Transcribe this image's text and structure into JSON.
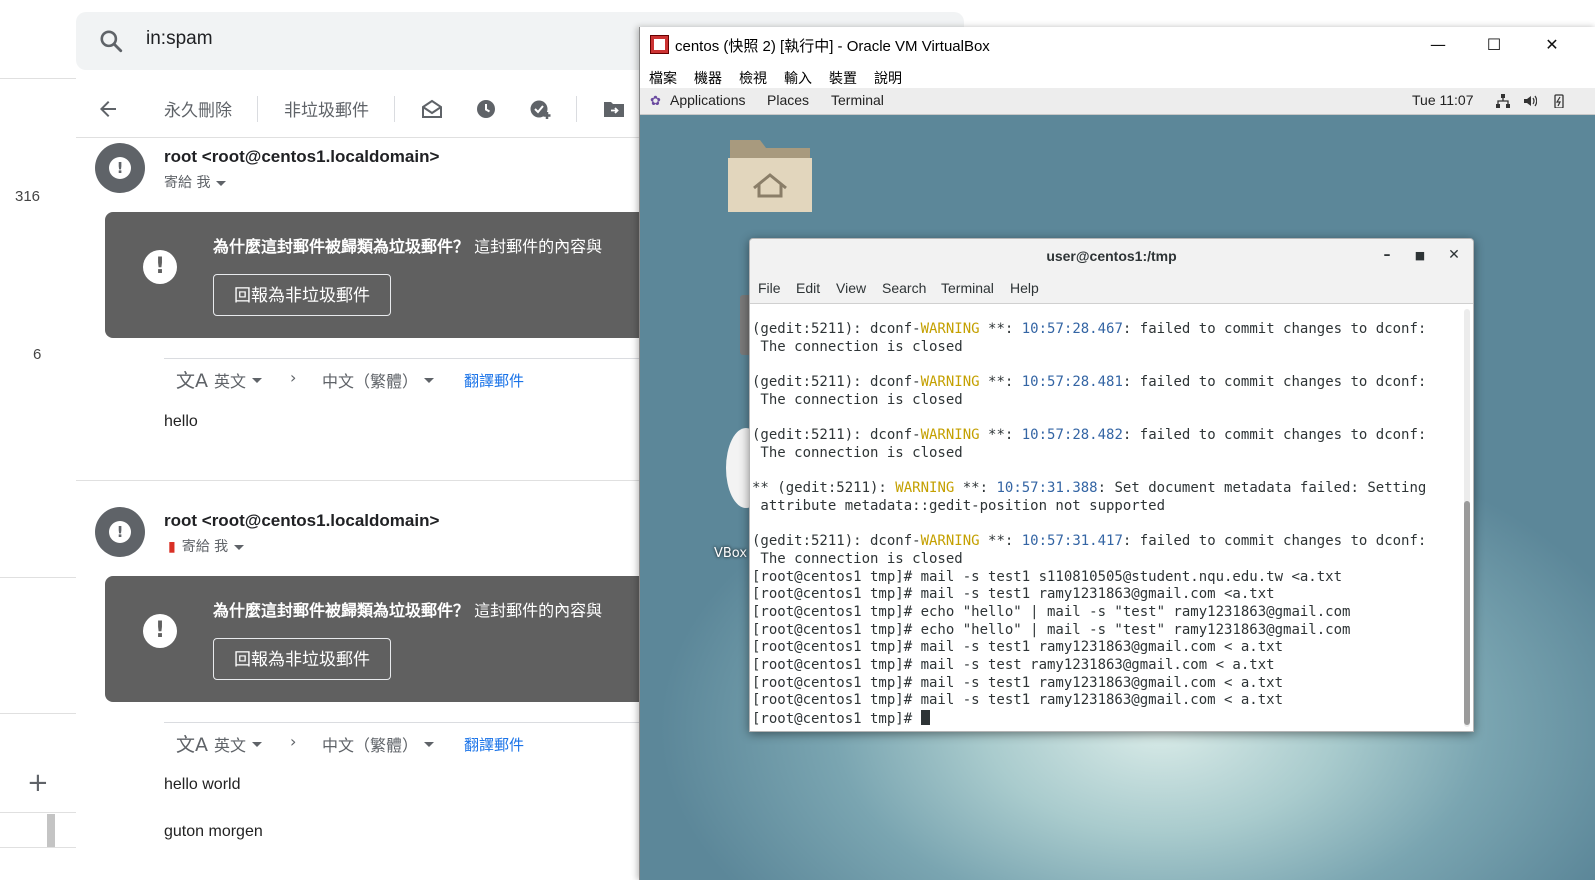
{
  "gmail": {
    "search": {
      "query": "in:spam"
    },
    "toolbar": {
      "delete_forever": "永久刪除",
      "not_spam": "非垃圾郵件"
    },
    "left_counts": [
      "316",
      "6"
    ],
    "add_label": "+",
    "messages": [
      {
        "sender": "root <root@centos1.localdomain>",
        "sent_to": "寄給 我",
        "banner_title": "為什麼這封郵件被歸類為垃圾郵件？",
        "banner_text": "這封郵件的內容與",
        "report_button": "回報為非垃圾郵件",
        "translate_from": "英文",
        "translate_to": "中文（繁體）",
        "translate_link": "翻譯郵件",
        "body": [
          "hello"
        ]
      },
      {
        "sender": "root <root@centos1.localdomain>",
        "sent_to": "寄給 我",
        "banner_title": "為什麼這封郵件被歸類為垃圾郵件？",
        "banner_text": "這封郵件的內容與",
        "report_button": "回報為非垃圾郵件",
        "translate_from": "英文",
        "translate_to": "中文（繁體）",
        "translate_link": "翻譯郵件",
        "body": [
          "hello world",
          "guton morgen"
        ]
      }
    ]
  },
  "vbox": {
    "title": "centos (快照 2) [執行中] - Oracle VM VirtualBox",
    "menu": [
      "檔案",
      "機器",
      "檢視",
      "輸入",
      "裝置",
      "說明"
    ],
    "controls": {
      "minimize": "—",
      "maximize": "☐",
      "close": "✕"
    },
    "guest_topbar": {
      "applications": "Applications",
      "places": "Places",
      "terminal": "Terminal",
      "clock": "Tue 11:07"
    },
    "desktop_label": "VBox"
  },
  "terminal": {
    "title": "user@centos1:/tmp",
    "menu": [
      "File",
      "Edit",
      "View",
      "Search",
      "Terminal",
      "Help"
    ],
    "lines": [
      {
        "a": "(gedit:5211): dconf-",
        "w": "WARNING",
        "b": " **: ",
        "t": "10:57:28.467",
        "c": ": failed to commit changes to dconf:"
      },
      {
        "a": " The connection is closed"
      },
      {
        "a": ""
      },
      {
        "a": "(gedit:5211): dconf-",
        "w": "WARNING",
        "b": " **: ",
        "t": "10:57:28.481",
        "c": ": failed to commit changes to dconf:"
      },
      {
        "a": " The connection is closed"
      },
      {
        "a": ""
      },
      {
        "a": "(gedit:5211): dconf-",
        "w": "WARNING",
        "b": " **: ",
        "t": "10:57:28.482",
        "c": ": failed to commit changes to dconf:"
      },
      {
        "a": " The connection is closed"
      },
      {
        "a": ""
      },
      {
        "a": "** (gedit:5211): ",
        "w": "WARNING",
        "b": " **: ",
        "t": "10:57:31.388",
        "c": ": Set document metadata failed: Setting"
      },
      {
        "a": " attribute metadata::gedit-position not supported"
      },
      {
        "a": ""
      },
      {
        "a": "(gedit:5211): dconf-",
        "w": "WARNING",
        "b": " **: ",
        "t": "10:57:31.417",
        "c": ": failed to commit changes to dconf:"
      },
      {
        "a": " The connection is closed"
      },
      {
        "a": "[root@centos1 tmp]# mail -s test1 s110810505@student.nqu.edu.tw <a.txt"
      },
      {
        "a": "[root@centos1 tmp]# mail -s test1 ramy1231863@gmail.com <a.txt"
      },
      {
        "a": "[root@centos1 tmp]# echo \"hello\" | mail -s \"test\" ramy1231863@gmail.com"
      },
      {
        "a": "[root@centos1 tmp]# echo \"hello\" | mail -s \"test\" ramy1231863@gmail.com"
      },
      {
        "a": "[root@centos1 tmp]# mail -s test1 ramy1231863@gmail.com < a.txt"
      },
      {
        "a": "[root@centos1 tmp]# mail -s test ramy1231863@gmail.com < a.txt"
      },
      {
        "a": "[root@centos1 tmp]# mail -s test1 ramy1231863@gmail.com < a.txt"
      },
      {
        "a": "[root@centos1 tmp]# mail -s test1 ramy1231863@gmail.com < a.txt"
      }
    ],
    "prompt": "[root@centos1 tmp]# "
  }
}
